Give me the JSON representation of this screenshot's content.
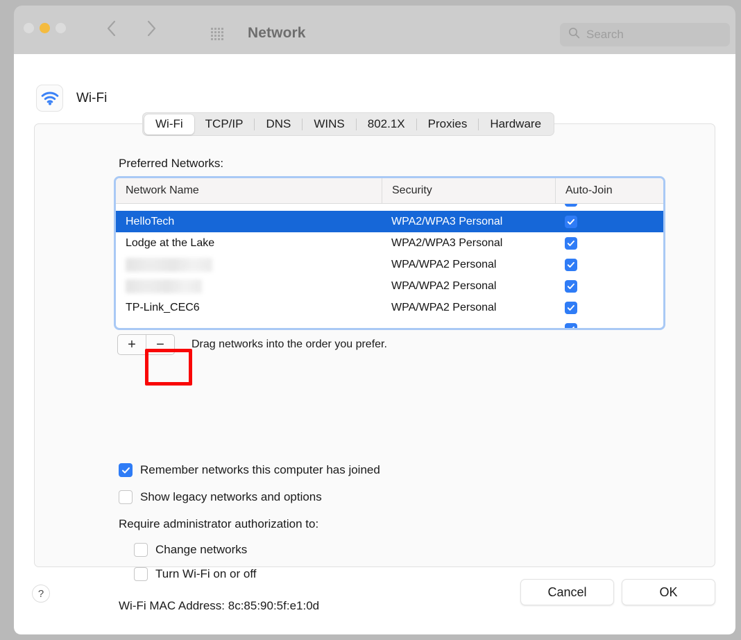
{
  "toolbar": {
    "title": "Network",
    "grid_icon": "grid-icon",
    "back_icon": "chevron-left-icon",
    "forward_icon": "chevron-right-icon",
    "traffic_lights": [
      "close",
      "minimize",
      "zoom"
    ],
    "search": {
      "icon": "search-icon",
      "placeholder": "Search",
      "value": ""
    }
  },
  "sheet": {
    "service_icon": "wifi-icon",
    "service_title": "Wi-Fi",
    "tabs": [
      {
        "label": "Wi-Fi",
        "active": true
      },
      {
        "label": "TCP/IP",
        "active": false
      },
      {
        "label": "DNS",
        "active": false
      },
      {
        "label": "WINS",
        "active": false
      },
      {
        "label": "802.1X",
        "active": false
      },
      {
        "label": "Proxies",
        "active": false
      },
      {
        "label": "Hardware",
        "active": false
      }
    ],
    "preferred_networks_label": "Preferred Networks:",
    "table": {
      "columns": [
        "Network Name",
        "Security",
        "Auto-Join"
      ],
      "rows": [
        {
          "name": "",
          "security": "",
          "auto_join": true,
          "selected": false,
          "clipped": true,
          "redacted": false
        },
        {
          "name": "HelloTech",
          "security": "WPA2/WPA3 Personal",
          "auto_join": true,
          "selected": true,
          "clipped": false,
          "redacted": false
        },
        {
          "name": "Lodge at the Lake",
          "security": "WPA2/WPA3 Personal",
          "auto_join": true,
          "selected": false,
          "clipped": false,
          "redacted": false
        },
        {
          "name": "",
          "security": "WPA/WPA2 Personal",
          "auto_join": true,
          "selected": false,
          "clipped": false,
          "redacted": true
        },
        {
          "name": "",
          "security": "WPA/WPA2 Personal",
          "auto_join": true,
          "selected": false,
          "clipped": false,
          "redacted": true
        },
        {
          "name": "TP-Link_CEC6",
          "security": "WPA/WPA2 Personal",
          "auto_join": true,
          "selected": false,
          "clipped": false,
          "redacted": false
        }
      ]
    },
    "add_button_label": "+",
    "remove_button_label": "−",
    "drag_hint": "Drag networks into the order you prefer.",
    "options": [
      {
        "label": "Remember networks this computer has joined",
        "checked": true
      },
      {
        "label": "Show legacy networks and options",
        "checked": false
      }
    ],
    "require_admin_label": "Require administrator authorization to:",
    "admin_options": [
      {
        "label": "Change networks",
        "checked": false
      },
      {
        "label": "Turn Wi-Fi on or off",
        "checked": false
      }
    ],
    "mac_address_line": "Wi-Fi MAC Address:  8c:85:90:5f:e1:0d"
  },
  "footer": {
    "help_label": "?",
    "cancel_label": "Cancel",
    "ok_label": "OK"
  },
  "annotation": {
    "highlight_color": "#f90606",
    "highlight_target": "remove-network-button"
  }
}
